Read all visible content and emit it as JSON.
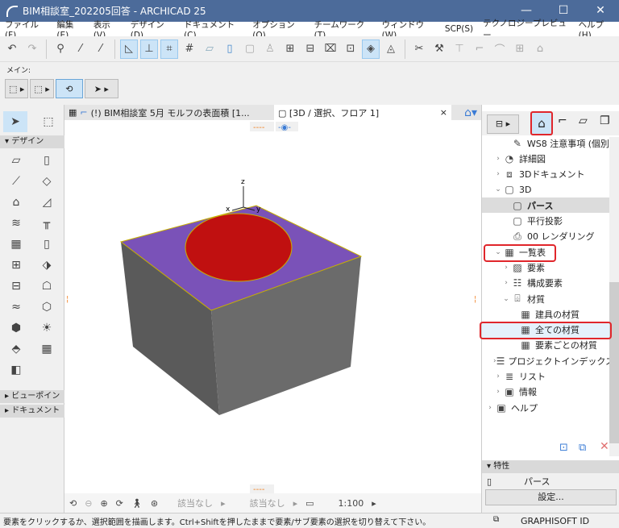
{
  "window": {
    "title": "BIM相談室_202205回答 - ARCHICAD 25",
    "minimize": "—",
    "maximize": "☐",
    "close": "✕"
  },
  "menu": [
    "ファイル(F)",
    "編集(E)",
    "表示(V)",
    "デザイン(D)",
    "ドキュメント(C)",
    "オプション(O)",
    "チームワーク(T)",
    "ウィンドウ(W)",
    "SCP(S)",
    "テクノロジープレビュー",
    "ヘルプ(H)"
  ],
  "toolbar": {
    "main_label": "メイン:"
  },
  "toolbox": {
    "sections": {
      "design": "デザイン",
      "viewpoint": "ビューポイント",
      "document": "ドキュメント"
    }
  },
  "tabs": [
    {
      "label": "(!) BIM相談室 5月 モルフの表面積 [1..."
    },
    {
      "label": "[3D / 選択、フロア 1]",
      "close": "×"
    }
  ],
  "viewport": {
    "axes": {
      "z": "z",
      "x": "x",
      "y": "y"
    },
    "colors": {
      "top": "#7a52b8",
      "hole": "#c01010",
      "side": "#5a5a5a",
      "front": "#6b6b6b"
    }
  },
  "view_bottom": {
    "layer_combo": "該当なし",
    "pen_set": "該当なし",
    "scale": "1:100"
  },
  "navigator": {
    "items": [
      {
        "label": "WS8 注意事項 (個別",
        "icon": "layout-icon",
        "level": 2,
        "chev": ""
      },
      {
        "label": "詳細図",
        "icon": "detail-icon",
        "level": 1,
        "chev": "›"
      },
      {
        "label": "3Dドキュメント",
        "icon": "3d-document-icon",
        "level": 1,
        "chev": "›"
      },
      {
        "label": "3D",
        "icon": "cube-icon",
        "level": 1,
        "chev": "⌄"
      },
      {
        "label": "パース",
        "icon": "cube-icon",
        "level": 2,
        "chev": "",
        "selected": true
      },
      {
        "label": "平行投影",
        "icon": "cube-icon",
        "level": 2,
        "chev": ""
      },
      {
        "label": "00 レンダリング",
        "icon": "camera-icon",
        "level": 2,
        "chev": ""
      },
      {
        "label": "一覧表",
        "icon": "table-icon",
        "level": 1,
        "chev": "⌄"
      },
      {
        "label": "要素",
        "icon": "hatch-icon",
        "level": 2,
        "chev": "›"
      },
      {
        "label": "構成要素",
        "icon": "components-icon",
        "level": 2,
        "chev": "›"
      },
      {
        "label": "材質",
        "icon": "brush-icon",
        "level": 2,
        "chev": "⌄"
      },
      {
        "label": "建具の材質",
        "icon": "table-icon",
        "level": 3,
        "chev": ""
      },
      {
        "label": "全ての材質",
        "icon": "table-icon",
        "level": 3,
        "chev": "",
        "hover": true
      },
      {
        "label": "要素ごとの材質",
        "icon": "table-icon",
        "level": 3,
        "chev": ""
      },
      {
        "label": "プロジェクトインデックス",
        "icon": "index-icon",
        "level": 1,
        "chev": "›"
      },
      {
        "label": "リスト",
        "icon": "list-icon",
        "level": 1,
        "chev": "›"
      },
      {
        "label": "情報",
        "icon": "info-icon",
        "level": 1,
        "chev": "›"
      },
      {
        "label": "ヘルプ",
        "icon": "help-icon",
        "level": 0,
        "chev": "›"
      }
    ],
    "properties_header": "特性",
    "properties_value": "パース",
    "settings_button": "設定..."
  },
  "status": {
    "message": "要素をクリックするか、選択範囲を描画します。Ctrl+Shiftを押したままで要素/サブ要素の選択を切り替えて下さい。",
    "graphisoft_id": "GRAPHISOFT ID"
  },
  "colors": {
    "accent": "#cce4f7",
    "highlight_red": "#e0262b",
    "titlebar": "#4c6b9a"
  }
}
